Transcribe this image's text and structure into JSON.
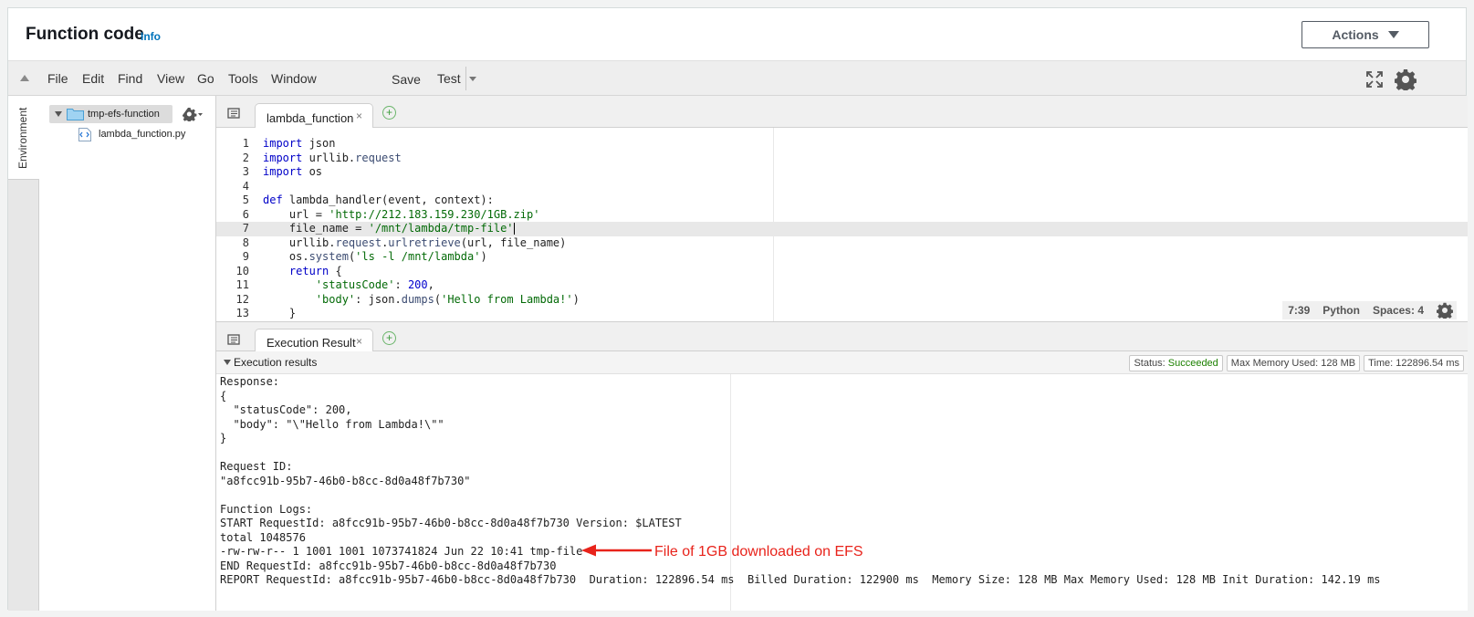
{
  "header": {
    "title": "Function code",
    "info_link": "Info",
    "actions_label": "Actions"
  },
  "menubar": {
    "items": [
      "File",
      "Edit",
      "Find",
      "View",
      "Go",
      "Tools",
      "Window"
    ],
    "save_label": "Save",
    "test_label": "Test",
    "icons": [
      "collapse-icon",
      "fullscreen-icon",
      "gear-icon"
    ]
  },
  "sidebar": {
    "env_tab_label": "Environment",
    "root_folder": "tmp-efs-function",
    "file": "lambda_function.py"
  },
  "editor": {
    "tab_label": "lambda_function",
    "close_symbol": "×",
    "add_symbol": "+",
    "lines": [
      {
        "n": "1",
        "html": "<span class=\"kw\">import</span> json"
      },
      {
        "n": "2",
        "html": "<span class=\"kw\">import</span> urllib.<span class=\"fn\">request</span>"
      },
      {
        "n": "3",
        "html": "<span class=\"kw\">import</span> os"
      },
      {
        "n": "4",
        "html": ""
      },
      {
        "n": "5",
        "html": "<span class=\"kw\">def</span> lambda_handler(event, context):"
      },
      {
        "n": "6",
        "html": "    url = <span class=\"str\">'http://212.183.159.230/1GB.zip'</span>"
      },
      {
        "n": "7",
        "html": "    file_name = <span class=\"str\">'/mnt/lambda/tmp-file'</span>"
      },
      {
        "n": "8",
        "html": "    urllib.<span class=\"fn\">request</span>.<span class=\"fn\">urlretrieve</span>(url, file_name)"
      },
      {
        "n": "9",
        "html": "    os.<span class=\"fn\">system</span>(<span class=\"str\">'ls -l /mnt/lambda'</span>)"
      },
      {
        "n": "10",
        "html": "    <span class=\"kw\">return</span> {"
      },
      {
        "n": "11",
        "html": "        <span class=\"str\">'statusCode'</span>: <span class=\"num\">200</span>,"
      },
      {
        "n": "12",
        "html": "        <span class=\"str\">'body'</span>: json.<span class=\"fn\">dumps</span>(<span class=\"str\">'Hello from Lambda!'</span>)"
      },
      {
        "n": "13",
        "html": "    }"
      }
    ],
    "active_line": 7,
    "status": {
      "cursor": "7:39",
      "language": "Python",
      "spaces": "Spaces: 4"
    }
  },
  "results": {
    "tab_label": "Execution Result",
    "section_label": "Execution results",
    "status_prefix": "Status: ",
    "status_value": "Succeeded",
    "max_memory": "Max Memory Used: 128 MB",
    "time": "Time: 122896.54 ms",
    "output_lines": [
      "Response:",
      "{",
      "  \"statusCode\": 200,",
      "  \"body\": \"\\\"Hello from Lambda!\\\"\"",
      "}",
      "",
      "Request ID:",
      "\"a8fcc91b-95b7-46b0-b8cc-8d0a48f7b730\"",
      "",
      "Function Logs:",
      "START RequestId: a8fcc91b-95b7-46b0-b8cc-8d0a48f7b730 Version: $LATEST",
      "total 1048576",
      "-rw-rw-r-- 1 1001 1001 1073741824 Jun 22 10:41 tmp-file",
      "END RequestId: a8fcc91b-95b7-46b0-b8cc-8d0a48f7b730",
      "REPORT RequestId: a8fcc91b-95b7-46b0-b8cc-8d0a48f7b730  Duration: 122896.54 ms  Billed Duration: 122900 ms  Memory Size: 128 MB Max Memory Used: 128 MB Init Duration: 142.19 ms"
    ],
    "annotation": "File of 1GB downloaded on EFS",
    "annotation_color": "#e8231b"
  }
}
